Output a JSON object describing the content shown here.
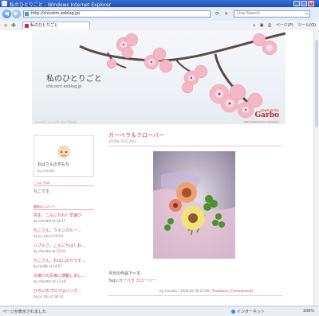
{
  "window": {
    "title": "私のひとりごと - Windows Internet Explorer",
    "controls": {
      "minimize": "_",
      "maximize": "□",
      "close": "×"
    }
  },
  "toolbar": {
    "address": "http://chicotm.exblog.jp/",
    "search_placeholder": "Live Search",
    "tab_title": "私のひとりごと",
    "tools": {
      "home": "⌂",
      "feeds": "▣",
      "print": "⎙",
      "page": "ページ(P)",
      "tool": "ツール(O)"
    }
  },
  "blog": {
    "title": "私のひとりごと",
    "url": "chicotm.exblog.jp",
    "powered": "powered by",
    "brand": "Garbo",
    "brand_url": "http://www.excite.co.jp/garbo",
    "nav": "リンク | トップ | マイブログ"
  },
  "sidebar": {
    "profile_name": "おばさんのきもち",
    "profile_by": "by chicotm",
    "heading1": "こんにちは",
    "text1": "ちこです。",
    "heading2": "最新のコメント",
    "comments": [
      {
        "text": "先生、こんにちわ！早速ひ",
        "by": "by chicotm at 14:17"
      },
      {
        "text": "ちこさん、ウォンカルー...",
        "by": "by pc_tiki at 19:54"
      },
      {
        "text": "パプルさ、こんにちは！お...",
        "by": "by chicotm at 15:01"
      },
      {
        "text": "ちこさん、おはしのりです...",
        "by": "by tuh86 at 14:57"
      },
      {
        "text": "夕焼けの写真に感動しまし...",
        "by": "by chicotm at 13:19"
      },
      {
        "text": "ひろいのプロフはリンク...",
        "by": "by pc_tiki at 18:14"
      }
    ]
  },
  "post": {
    "title": "ガーベラ＆クローバー",
    "date": "2008年 02月 28日",
    "body": "今日の作品で〜す。",
    "tags_label": "Tags:",
    "tags": "ガーベラ クローバー",
    "footer_by": "by chicotm",
    "footer_time": "2008-02-28 13:09",
    "trackback": "Trackback",
    "comments": "Comments(4)"
  },
  "status": {
    "text": "ページが表示されました",
    "zone": "インターネット",
    "zoom": "100%"
  },
  "colors": {
    "accent": "#c0396b",
    "link": "#c0396b",
    "chrome": "#1d4fb8"
  }
}
